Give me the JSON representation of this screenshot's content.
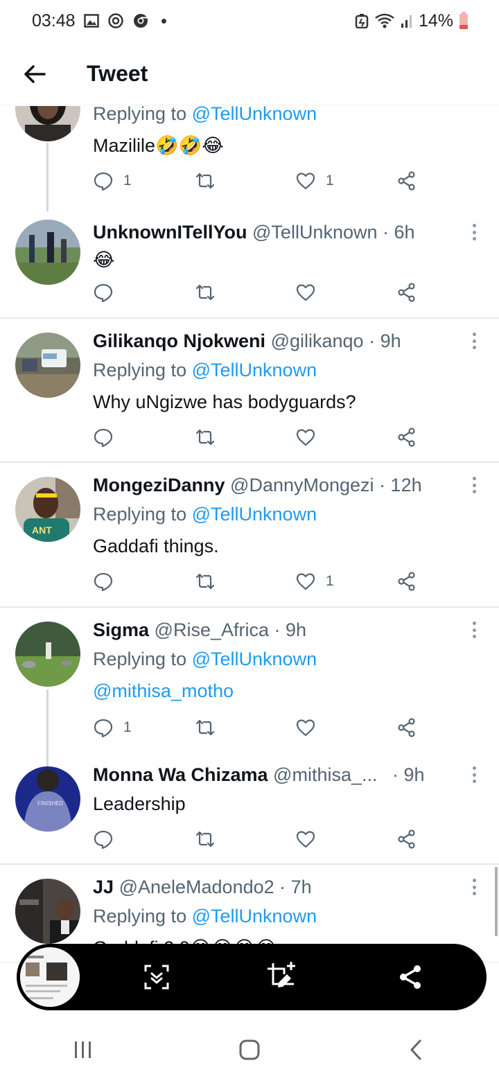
{
  "status_bar": {
    "time": "03:48",
    "battery": "14%",
    "left_icons": [
      "gallery-icon",
      "sync-icon",
      "chrome-icon",
      "notification-dot"
    ],
    "right_icons": [
      "battery-saver-icon",
      "wifi-icon",
      "signal-icon",
      "battery-icon"
    ]
  },
  "header": {
    "title": "Tweet",
    "back_icon": "arrow-left-icon"
  },
  "colors": {
    "link": "#1d9bf0",
    "muted": "#536471",
    "text": "#0f1419",
    "divider": "#e1e8ed",
    "thread_line": "#cfd9de"
  },
  "tweets": [
    {
      "replying_label": "Replying to",
      "replying_to": "@TellUnknown",
      "text": "Mazilile🤣🤣😂",
      "reply_count": "1",
      "like_count": "1"
    },
    {
      "name": "UnknownITellYou",
      "handle": "@TellUnknown",
      "time": "· 6h",
      "text": "😂"
    },
    {
      "name": "Gilikanqo Njokweni",
      "handle": "@gilikanqo",
      "time": "· 9h",
      "replying_label": "Replying to",
      "replying_to": "@TellUnknown",
      "text": "Why uNgizwe has bodyguards?"
    },
    {
      "name": "MongeziDanny",
      "handle": "@DannyMongezi",
      "time": "· 12h",
      "replying_label": "Replying to",
      "replying_to": "@TellUnknown",
      "text": "Gaddafi things.",
      "like_count": "1"
    },
    {
      "name": "Sigma",
      "handle": "@Rise_Africa",
      "time": "· 9h",
      "replying_label": "Replying to",
      "replying_to": "@TellUnknown",
      "text": "@mithisa_motho",
      "reply_count": "1"
    },
    {
      "name": "Monna Wa Chizama",
      "handle": "@mithisa_...",
      "time": "· 9h",
      "text": "Leadership"
    },
    {
      "name": "JJ",
      "handle": "@AneleMadondo2",
      "time": "· 7h",
      "replying_label": "Replying to",
      "replying_to": "@TellUnknown",
      "text": "Gaddafi 2.0😂😂😂😂"
    }
  ],
  "capture_toolbar": {
    "buttons": [
      "scroll-capture-icon",
      "crop-edit-icon",
      "share-icon"
    ]
  },
  "nav_bar": {
    "buttons": [
      "recents-icon",
      "home-icon",
      "back-icon"
    ]
  }
}
